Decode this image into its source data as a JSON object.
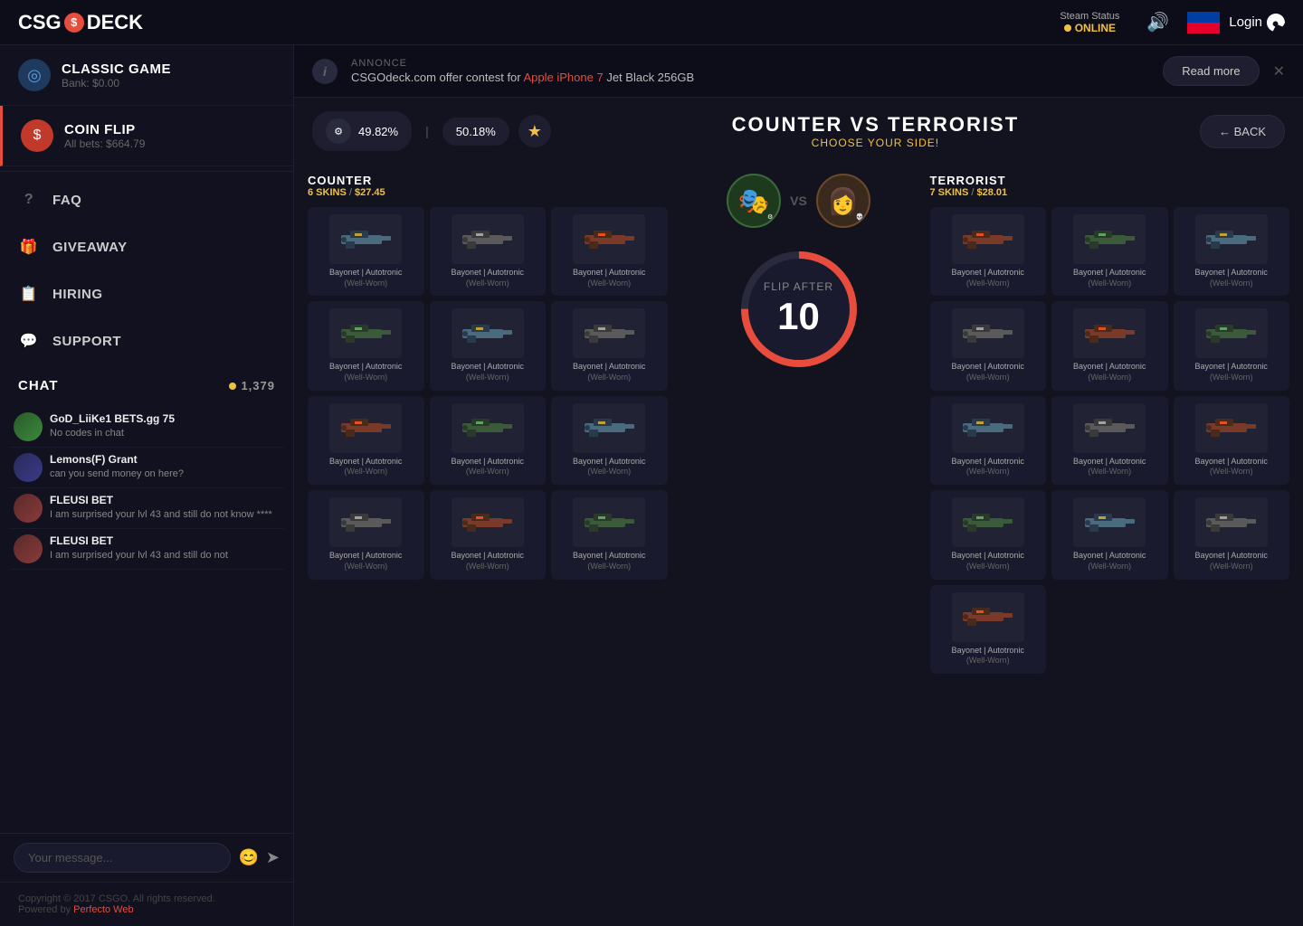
{
  "nav": {
    "logo": "CSGO DECK",
    "logo_icon": "$",
    "steam_status_label": "Steam Status",
    "steam_status_online": "ONLINE",
    "login_label": "Login"
  },
  "sidebar": {
    "games": [
      {
        "id": "classic",
        "title": "CLASSIC GAME",
        "subtitle": "Bank: $0.00",
        "active": false
      },
      {
        "id": "coinflip",
        "title": "COIN FLIP",
        "subtitle": "All bets: $664.79",
        "active": true
      }
    ],
    "menu_items": [
      {
        "id": "faq",
        "label": "FAQ"
      },
      {
        "id": "giveaway",
        "label": "GIVEAWAY"
      },
      {
        "id": "hiring",
        "label": "HIRING"
      },
      {
        "id": "support",
        "label": "SUPPORT"
      }
    ],
    "chat": {
      "title": "CHAT",
      "count": "1,379",
      "messages": [
        {
          "id": 1,
          "username": "GoD_LiiKe1 BETS.gg 75",
          "text": "No codes in chat",
          "avatar_class": "avatar-god"
        },
        {
          "id": 2,
          "username": "Lemons(F) Grant",
          "text": "can you send money on here?",
          "avatar_class": "avatar-lemons"
        },
        {
          "id": 3,
          "username": "FLEUSI BET",
          "text": "I am surprised your lvl 43 and still do not know ****",
          "avatar_class": "avatar-fleusi"
        },
        {
          "id": 4,
          "username": "FLEUSI BET",
          "text": "I am surprised your lvl 43 and still do not",
          "avatar_class": "avatar-fleusi2"
        }
      ],
      "input_placeholder": "Your message...",
      "emoji_icon": "😊",
      "send_icon": "➤"
    },
    "footer_copyright": "Copyright © 2017 CSGO. All rights reserved.",
    "footer_powered": "Powered by ",
    "footer_link": "Perfecto Web"
  },
  "announcement": {
    "label": "ANNONCE",
    "text_before": "CSGOdeck.com offer contest for ",
    "highlight": "Apple iPhone 7",
    "text_after": " Jet Black 256GB",
    "read_more": "Read more"
  },
  "game": {
    "percentage_counter": "49.82%",
    "percentage_terrorist": "50.18%",
    "title": "COUNTER VS TERRORIST",
    "subtitle": "CHOOSE YOUR SIDE!",
    "back_label": "← BACK",
    "counter": {
      "name": "COUNTER",
      "skins_count": "6 SKINS",
      "value": "$27.45",
      "items": [
        {
          "name": "Bayonet | Autotronic",
          "condition": "(Well-Worn)"
        },
        {
          "name": "Bayonet | Autotronic",
          "condition": "(Well-Worn)"
        },
        {
          "name": "Bayonet | Autotronic",
          "condition": "(Well-Worn)"
        },
        {
          "name": "Bayonet | Autotronic",
          "condition": "(Well-Worn)"
        },
        {
          "name": "Bayonet | Autotronic",
          "condition": "(Well-Worn)"
        },
        {
          "name": "Bayonet | Autotronic",
          "condition": "(Well-Worn)"
        },
        {
          "name": "Bayonet | Autotronic",
          "condition": "(Well-Worn)"
        },
        {
          "name": "Bayonet | Autotronic",
          "condition": "(Well-Worn)"
        },
        {
          "name": "Bayonet | Autotronic",
          "condition": "(Well-Worn)"
        },
        {
          "name": "Bayonet | Autotronic",
          "condition": "(Well-Worn)"
        },
        {
          "name": "Bayonet | Autotronic",
          "condition": "(Well-Worn)"
        },
        {
          "name": "Bayonet | Autotronic",
          "condition": "(Well-Worn)"
        }
      ]
    },
    "terrorist": {
      "name": "TERRORIST",
      "skins_count": "7 SKINS",
      "value": "$28.01",
      "items": [
        {
          "name": "Bayonet | Autotronic",
          "condition": "(Well-Worn)"
        },
        {
          "name": "Bayonet | Autotronic",
          "condition": "(Well-Worn)"
        },
        {
          "name": "Bayonet | Autotronic",
          "condition": "(Well-Worn)"
        },
        {
          "name": "Bayonet | Autotronic",
          "condition": "(Well-Worn)"
        },
        {
          "name": "Bayonet | Autotronic",
          "condition": "(Well-Worn)"
        },
        {
          "name": "Bayonet | Autotronic",
          "condition": "(Well-Worn)"
        },
        {
          "name": "Bayonet | Autotronic",
          "condition": "(Well-Worn)"
        },
        {
          "name": "Bayonet | Autotronic",
          "condition": "(Well-Worn)"
        },
        {
          "name": "Bayonet | Autotronic",
          "condition": "(Well-Worn)"
        },
        {
          "name": "Bayonet | Autotronic",
          "condition": "(Well-Worn)"
        },
        {
          "name": "Bayonet | Autotronic",
          "condition": "(Well-Worn)"
        },
        {
          "name": "Bayonet | Autotronic",
          "condition": "(Well-Worn)"
        },
        {
          "name": "Bayonet | Autotronic",
          "condition": "(Well-Worn)"
        }
      ]
    },
    "flip_after": "FLIP AFTER",
    "flip_number": "10",
    "player_counter_emoji": "🎭",
    "player_terrorist_emoji": "👩",
    "vs_label": "VS"
  },
  "colors": {
    "accent_red": "#e74c3c",
    "accent_gold": "#f0c040",
    "bg_dark": "#0d0d1a",
    "bg_medium": "#13131f",
    "bg_light": "#1a1a2e"
  }
}
